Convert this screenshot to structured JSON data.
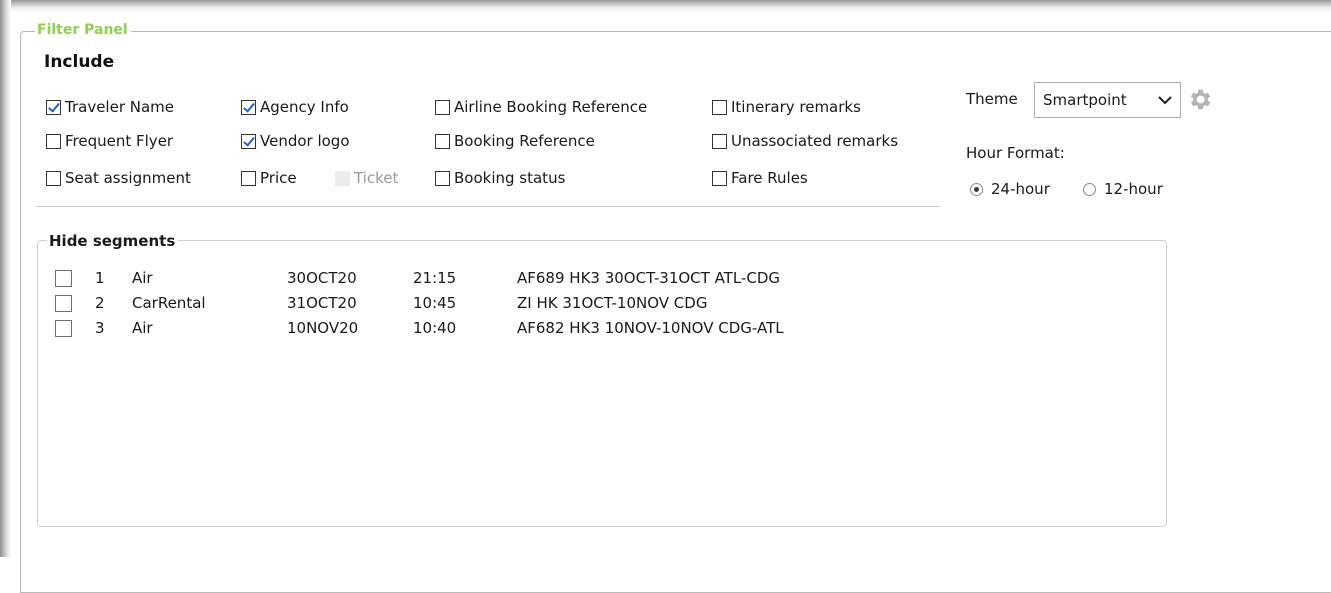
{
  "panel": {
    "legend": "Filter Panel",
    "legend_color": "#8fd14f",
    "include_title": "Include"
  },
  "include_options": [
    {
      "label": "Traveler Name",
      "checked": true,
      "enabled": true
    },
    {
      "label": "Agency Info",
      "checked": true,
      "enabled": true
    },
    {
      "label": "Airline Booking Reference",
      "checked": false,
      "enabled": true
    },
    {
      "label": "Itinerary remarks",
      "checked": false,
      "enabled": true
    },
    {
      "label": "Frequent Flyer",
      "checked": false,
      "enabled": true
    },
    {
      "label": "Vendor logo",
      "checked": true,
      "enabled": true
    },
    {
      "label": "Booking Reference",
      "checked": false,
      "enabled": true
    },
    {
      "label": "Unassociated remarks",
      "checked": false,
      "enabled": true
    },
    {
      "label": "Seat assignment",
      "checked": false,
      "enabled": true
    },
    {
      "label": "Price",
      "checked": false,
      "enabled": true
    },
    {
      "label": "Ticket",
      "checked": false,
      "enabled": false
    },
    {
      "label": "Booking status",
      "checked": false,
      "enabled": true
    },
    {
      "label": "Fare Rules",
      "checked": false,
      "enabled": true
    }
  ],
  "theme": {
    "label": "Theme",
    "selected": "Smartpoint",
    "icon": "gear-icon"
  },
  "hour_format": {
    "label": "Hour Format:",
    "options": [
      {
        "label": "24-hour",
        "selected": true
      },
      {
        "label": "12-hour",
        "selected": false
      }
    ]
  },
  "segments": {
    "legend": "Hide segments",
    "rows": [
      {
        "num": "1",
        "type": "Air",
        "date": "30OCT20",
        "time": "21:15",
        "desc": "AF689 HK3 30OCT-31OCT ATL-CDG",
        "checked": false
      },
      {
        "num": "2",
        "type": "CarRental",
        "date": "31OCT20",
        "time": "10:45",
        "desc": "ZI HK 31OCT-10NOV CDG",
        "checked": false
      },
      {
        "num": "3",
        "type": "Air",
        "date": "10NOV20",
        "time": "10:40",
        "desc": "AF682 HK3 10NOV-10NOV CDG-ATL",
        "checked": false
      }
    ]
  }
}
